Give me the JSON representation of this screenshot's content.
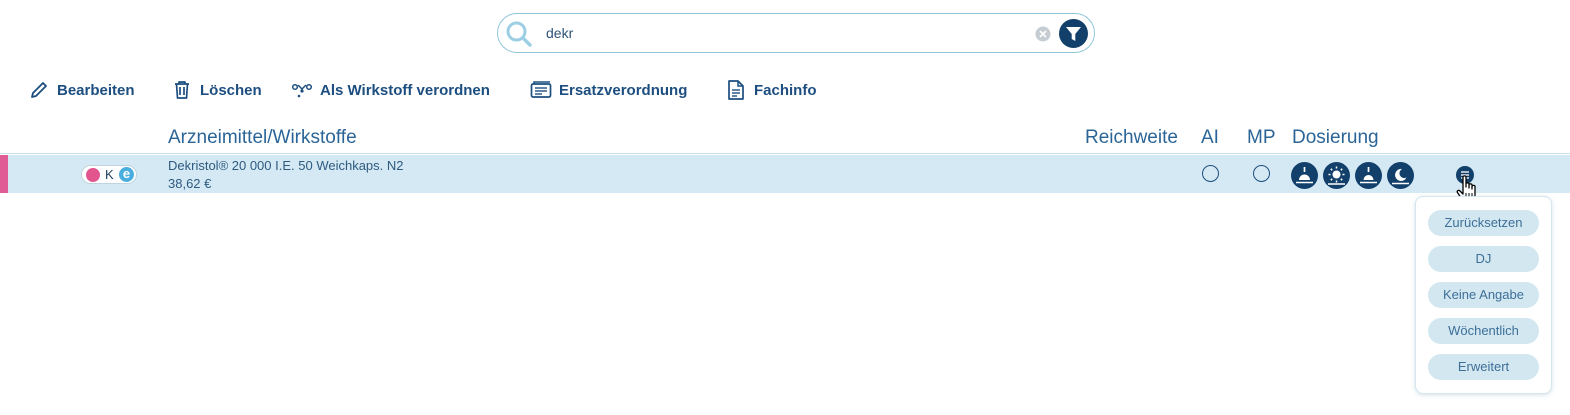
{
  "search": {
    "value": "dekr",
    "placeholder": ""
  },
  "toolbar": {
    "edit_label": "Bearbeiten",
    "delete_label": "Löschen",
    "substance_label": "Als Wirkstoff verordnen",
    "replacement_label": "Ersatzverordnung",
    "fachinfo_label": "Fachinfo"
  },
  "table": {
    "headers": {
      "drug": "Arzneimittel/Wirkstoffe",
      "reach": "Reichweite",
      "ai": "AI",
      "mp": "MP",
      "dosage": "Dosierung"
    },
    "rows": [
      {
        "badge_letter": "K",
        "badge_e": "e",
        "name": "Dekristol® 20 000 I.E. 50 Weichkaps. N2",
        "price": "38,62 €",
        "dosage_icons": [
          "sunrise-icon",
          "sun-icon",
          "sunset-icon",
          "moon-icon"
        ]
      }
    ]
  },
  "dosage_menu": {
    "options": [
      "Zurücksetzen",
      "DJ",
      "Keine Angabe",
      "Wöchentlich",
      "Erweitert"
    ]
  },
  "colors": {
    "accent_dark": "#12406b",
    "row_highlight": "#d4e9f3",
    "marker": "#e05c95",
    "link": "#1d4e80"
  }
}
